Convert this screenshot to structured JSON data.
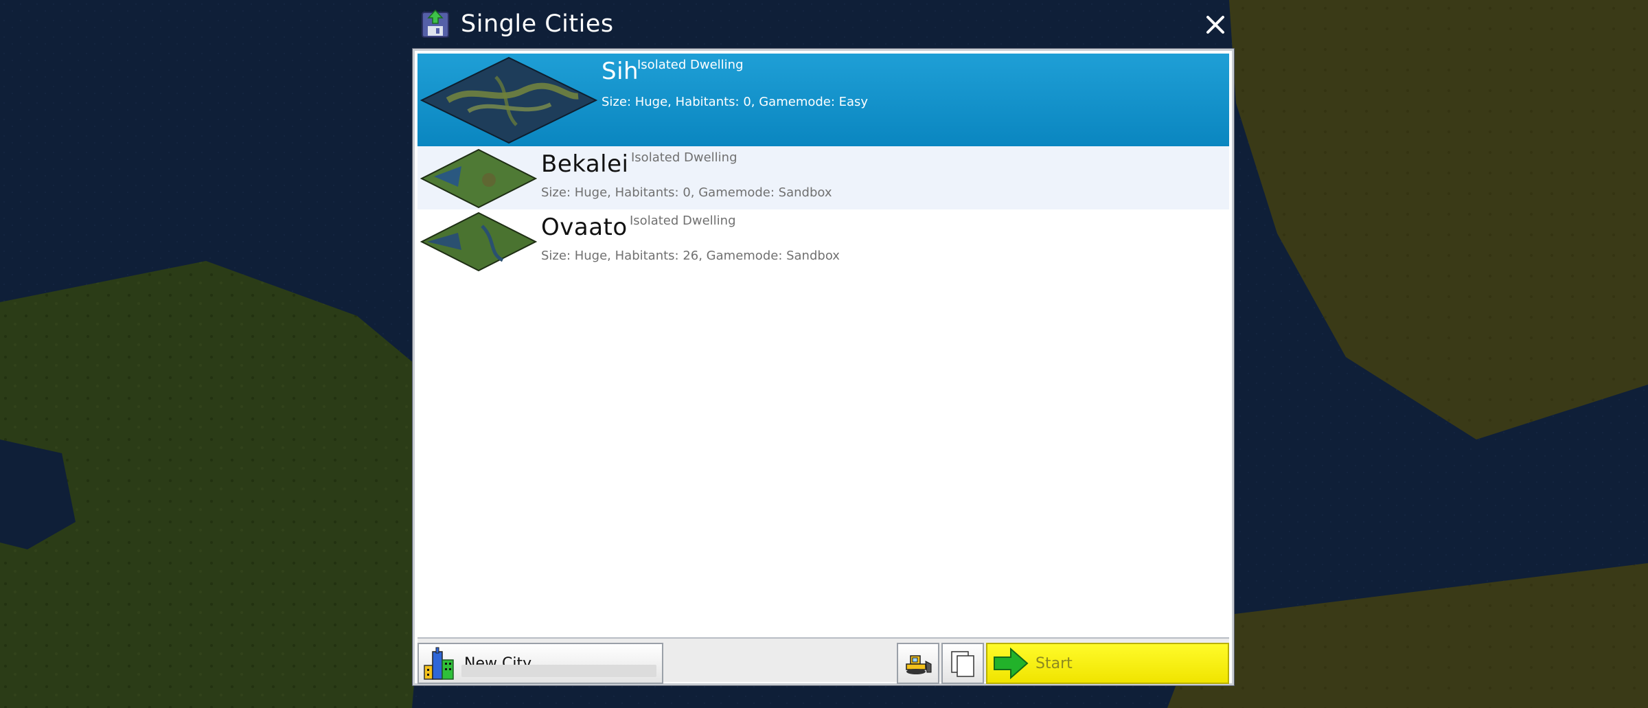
{
  "window": {
    "title": "Single Cities",
    "close_label": "✕"
  },
  "cities": [
    {
      "name": "Sih",
      "kind": "Isolated Dwelling",
      "info": "Size: Huge, Habitants: 0, Gamemode: Easy",
      "selected": true
    },
    {
      "name": "Bekalei",
      "kind": "Isolated Dwelling",
      "info": "Size: Huge, Habitants: 0, Gamemode: Sandbox",
      "selected": false
    },
    {
      "name": "Ovaato",
      "kind": "Isolated Dwelling",
      "info": "Size: Huge, Habitants: 26, Gamemode: Sandbox",
      "selected": false
    }
  ],
  "toolbar": {
    "new_city_label": "New City",
    "start_label": "Start"
  },
  "colors": {
    "selected_row": "#0a86c0",
    "start_button": "#f7ee00",
    "start_arrow": "#22b22a"
  },
  "icons": {
    "title": "save-disk-icon",
    "close": "close-icon",
    "new_city": "city-buildings-icon",
    "bulldozer": "bulldozer-icon",
    "copy": "copy-icon",
    "start": "green-arrow-icon"
  }
}
